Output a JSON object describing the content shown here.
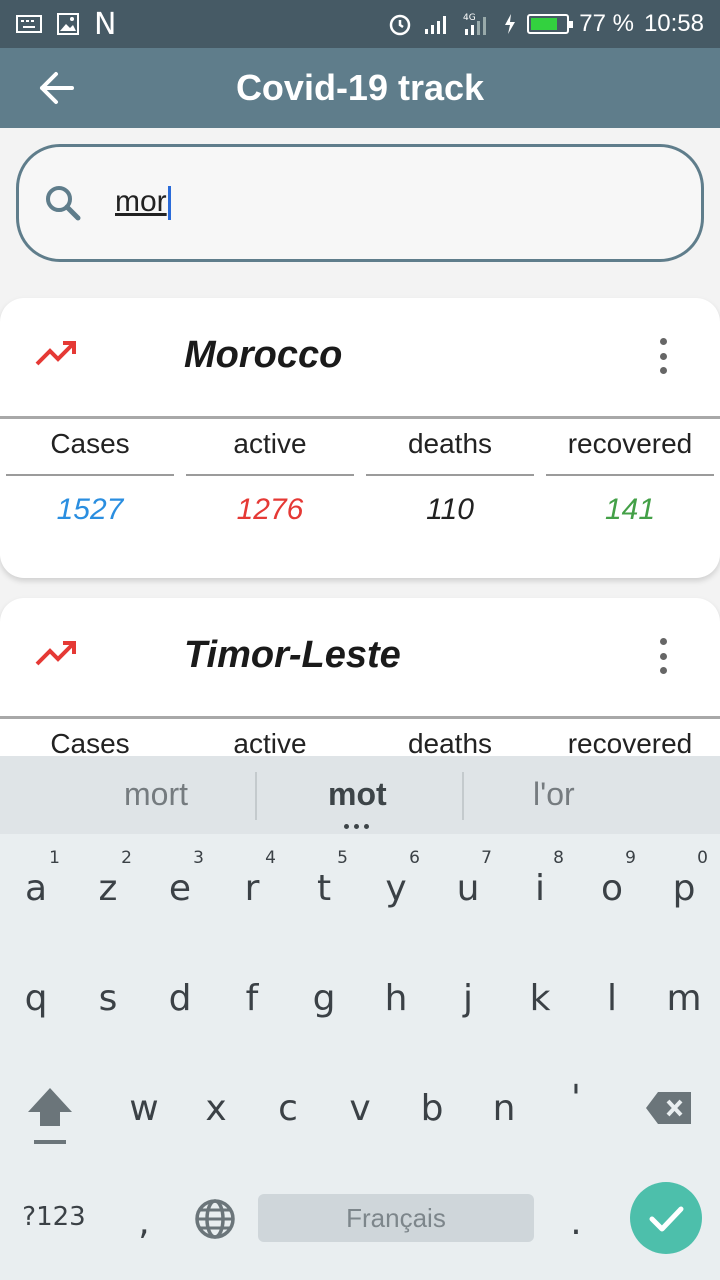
{
  "status_bar": {
    "battery_percent": "77 %",
    "time": "10:58",
    "network": "4G",
    "left_letter": "N",
    "battery_level": 0.77,
    "battery_color": "#33d13f"
  },
  "app_bar": {
    "title": "Covid-19 track",
    "back_icon": "arrow-left-icon"
  },
  "search": {
    "value": "mor",
    "icon": "search-icon"
  },
  "countries": [
    {
      "name": "Morocco",
      "cases": "1527",
      "active": "1276",
      "deaths": "110",
      "recovered": "141"
    },
    {
      "name": "Timor-Leste"
    }
  ],
  "stat_headers": {
    "cases": "Cases",
    "active": "active",
    "deaths": "deaths",
    "recovered": "recovered"
  },
  "colors": {
    "cases": "#2a8ee0",
    "active": "#e53935",
    "deaths": "#222222",
    "recovered": "#43a047",
    "appbar": "#5f7d8b",
    "statusbar": "#465a65"
  },
  "keyboard": {
    "suggestions": [
      "mort",
      "mot",
      "l'or"
    ],
    "row1": [
      "a",
      "z",
      "e",
      "r",
      "t",
      "y",
      "u",
      "i",
      "o",
      "p"
    ],
    "row1_numbers": [
      "1",
      "2",
      "3",
      "4",
      "5",
      "6",
      "7",
      "8",
      "9",
      "0"
    ],
    "row2": [
      "q",
      "s",
      "d",
      "f",
      "g",
      "h",
      "j",
      "k",
      "l",
      "m"
    ],
    "row3": [
      "w",
      "x",
      "c",
      "v",
      "b",
      "n",
      "'"
    ],
    "symbols_key": "?123",
    "comma": ",",
    "period": ".",
    "space_label": "Français"
  }
}
